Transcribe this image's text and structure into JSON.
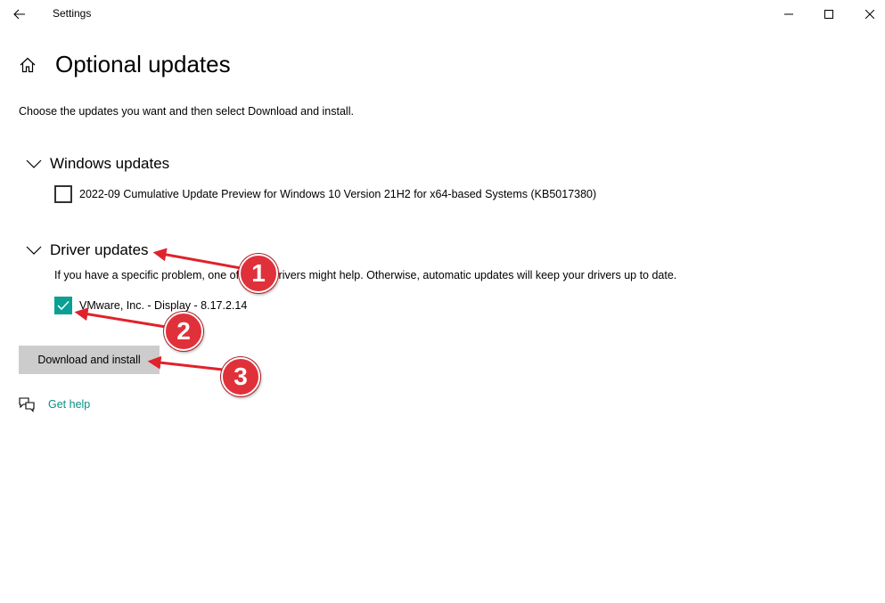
{
  "window": {
    "title": "Settings"
  },
  "page": {
    "title": "Optional updates",
    "intro": "Choose the updates you want and then select Download and install."
  },
  "windows_updates": {
    "title": "Windows updates",
    "items": [
      {
        "label": "2022-09 Cumulative Update Preview for Windows 10 Version 21H2 for x64-based Systems (KB5017380)",
        "checked": false
      }
    ]
  },
  "driver_updates": {
    "title": "Driver updates",
    "description": "If you have a specific problem, one of these drivers might help. Otherwise, automatic updates will keep your drivers up to date.",
    "items": [
      {
        "label": "VMware, Inc. - Display - 8.17.2.14",
        "checked": true
      }
    ]
  },
  "actions": {
    "download_label": "Download and install",
    "help_label": "Get help"
  },
  "annotations": {
    "badge1": "1",
    "badge2": "2",
    "badge3": "3"
  },
  "colors": {
    "accent": "#0aa094",
    "link": "#0a8f86",
    "button_bg": "#cccccc",
    "annotation_red": "#e0313a"
  },
  "icons": {
    "back": "back-arrow-icon",
    "home": "home-icon",
    "minimize": "minimize-icon",
    "maximize": "maximize-icon",
    "close": "close-icon",
    "chevron": "chevron-down-icon",
    "check": "checkmark-icon",
    "help": "chat-help-icon"
  }
}
